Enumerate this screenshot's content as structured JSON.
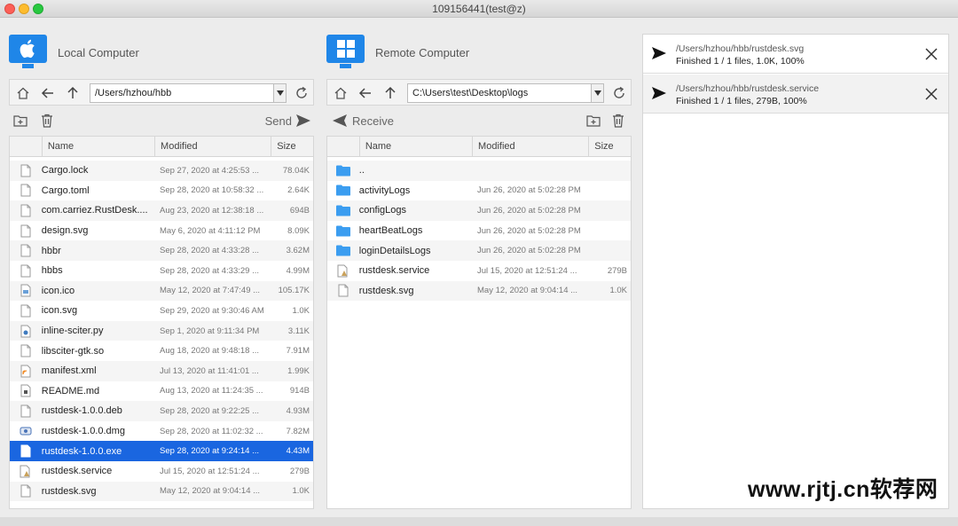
{
  "window": {
    "title": "109156441(test@z)"
  },
  "local": {
    "title": "Local Computer",
    "path": "/Users/hzhou/hbb",
    "send_label": "Send",
    "columns": {
      "name": "Name",
      "modified": "Modified",
      "size": "Size"
    },
    "files": [
      {
        "icon": "file-icon",
        "name": "Cargo.lock",
        "modified": "Sep 27, 2020 at 4:25:53 ...",
        "size": "78.04K"
      },
      {
        "icon": "file-icon",
        "name": "Cargo.toml",
        "modified": "Sep 28, 2020 at 10:58:32 ...",
        "size": "2.64K"
      },
      {
        "icon": "file-icon",
        "name": "com.carriez.RustDesk....",
        "modified": "Aug 23, 2020 at 12:38:18 ...",
        "size": "694B"
      },
      {
        "icon": "file-icon",
        "name": "design.svg",
        "modified": "May 6, 2020 at 4:11:12 PM",
        "size": "8.09K"
      },
      {
        "icon": "file-icon",
        "name": "hbbr",
        "modified": "Sep 28, 2020 at 4:33:28 ...",
        "size": "3.62M"
      },
      {
        "icon": "file-icon",
        "name": "hbbs",
        "modified": "Sep 28, 2020 at 4:33:29 ...",
        "size": "4.99M"
      },
      {
        "icon": "image-file-icon",
        "name": "icon.ico",
        "modified": "May 12, 2020 at 7:47:49 ...",
        "size": "105.17K"
      },
      {
        "icon": "file-icon",
        "name": "icon.svg",
        "modified": "Sep 29, 2020 at 9:30:46 AM",
        "size": "1.0K"
      },
      {
        "icon": "python-file-icon",
        "name": "inline-sciter.py",
        "modified": "Sep 1, 2020 at 9:11:34 PM",
        "size": "3.11K"
      },
      {
        "icon": "file-icon",
        "name": "libsciter-gtk.so",
        "modified": "Aug 18, 2020 at 9:48:18 ...",
        "size": "7.91M"
      },
      {
        "icon": "xml-file-icon",
        "name": "manifest.xml",
        "modified": "Jul 13, 2020 at 11:41:01 ...",
        "size": "1.99K"
      },
      {
        "icon": "markdown-file-icon",
        "name": "README.md",
        "modified": "Aug 13, 2020 at 11:24:35 ...",
        "size": "914B"
      },
      {
        "icon": "file-icon",
        "name": "rustdesk-1.0.0.deb",
        "modified": "Sep 28, 2020 at 9:22:25 ...",
        "size": "4.93M"
      },
      {
        "icon": "disk-image-icon",
        "name": "rustdesk-1.0.0.dmg",
        "modified": "Sep 28, 2020 at 11:02:32 ...",
        "size": "7.82M"
      },
      {
        "icon": "file-icon",
        "name": "rustdesk-1.0.0.exe",
        "modified": "Sep 28, 2020 at 9:24:14 ...",
        "size": "4.43M",
        "selected": true
      },
      {
        "icon": "service-file-icon",
        "name": "rustdesk.service",
        "modified": "Jul 15, 2020 at 12:51:24 ...",
        "size": "279B"
      },
      {
        "icon": "file-icon",
        "name": "rustdesk.svg",
        "modified": "May 12, 2020 at 9:04:14 ...",
        "size": "1.0K"
      }
    ]
  },
  "remote": {
    "title": "Remote Computer",
    "path": "C:\\Users\\test\\Desktop\\logs",
    "receive_label": "Receive",
    "columns": {
      "name": "Name",
      "modified": "Modified",
      "size": "Size"
    },
    "files": [
      {
        "icon": "folder-icon",
        "name": "..",
        "modified": "",
        "size": ""
      },
      {
        "icon": "folder-icon",
        "name": "activityLogs",
        "modified": "Jun 26, 2020 at 5:02:28 PM",
        "size": ""
      },
      {
        "icon": "folder-icon",
        "name": "configLogs",
        "modified": "Jun 26, 2020 at 5:02:28 PM",
        "size": ""
      },
      {
        "icon": "folder-icon",
        "name": "heartBeatLogs",
        "modified": "Jun 26, 2020 at 5:02:28 PM",
        "size": ""
      },
      {
        "icon": "folder-icon",
        "name": "loginDetailsLogs",
        "modified": "Jun 26, 2020 at 5:02:28 PM",
        "size": ""
      },
      {
        "icon": "service-file-icon",
        "name": "rustdesk.service",
        "modified": "Jul 15, 2020 at 12:51:24 ...",
        "size": "279B"
      },
      {
        "icon": "file-icon",
        "name": "rustdesk.svg",
        "modified": "May 12, 2020 at 9:04:14 ...",
        "size": "1.0K"
      }
    ]
  },
  "transfers": [
    {
      "path": "/Users/hzhou/hbb/rustdesk.svg",
      "status": "Finished 1 / 1 files, 1.0K, 100%"
    },
    {
      "path": "/Users/hzhou/hbb/rustdesk.service",
      "status": "Finished 1 / 1 files, 279B, 100%"
    }
  ],
  "watermark": "www.rjtj.cn软荐网",
  "colors": {
    "accent": "#1a66e0",
    "os_logo": "#1f86e8",
    "folder": "#3b9df0"
  }
}
